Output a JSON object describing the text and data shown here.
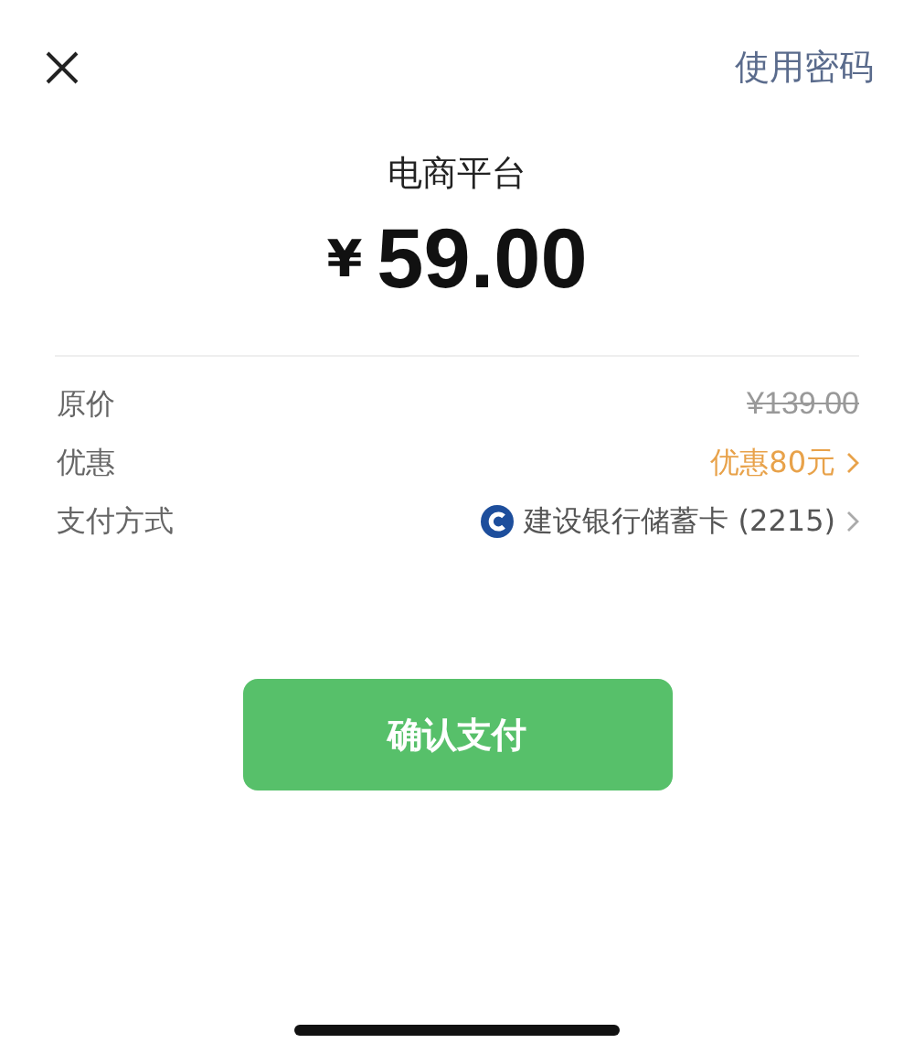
{
  "header": {
    "action": "使用密码"
  },
  "merchant": "电商平台",
  "amount": {
    "currency": "¥",
    "value": "59.00"
  },
  "rows": [
    {
      "kind": "original",
      "label": "原价",
      "value": "¥139.00"
    },
    {
      "kind": "discount",
      "label": "优惠",
      "value": "优惠80元"
    },
    {
      "kind": "bank",
      "label": "支付方式",
      "value": "建设银行储蓄卡 (2215)"
    }
  ],
  "confirm_button": "确认支付"
}
